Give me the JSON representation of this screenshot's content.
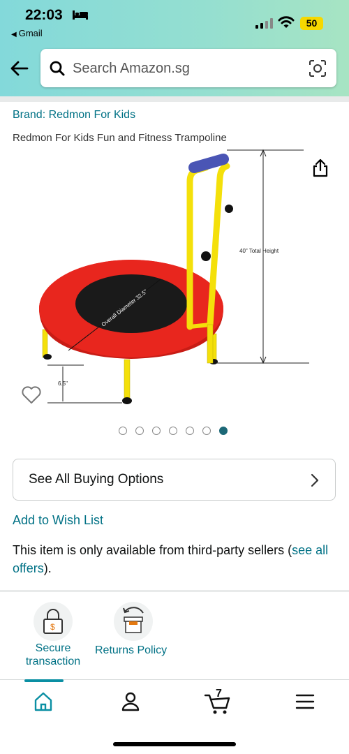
{
  "status": {
    "time": "22:03",
    "back_app": "Gmail",
    "battery": "50"
  },
  "search": {
    "placeholder": "Search Amazon.sg"
  },
  "product": {
    "brand": "Brand: Redmon For Kids",
    "title": "Redmon For Kids Fun and Fitness Trampoline",
    "image_labels": {
      "height": "40\" Total Height",
      "diameter": "Overall Diameter 32.5\"",
      "leg": "6.5\""
    },
    "carousel_count": 7,
    "carousel_active": 7
  },
  "buying_options": {
    "label": "See All Buying Options"
  },
  "wishlist": {
    "label": "Add to Wish List"
  },
  "availability": {
    "text": "This item is only available from third-party sellers (",
    "link": "see all offers",
    "suffix": ")."
  },
  "badges": [
    {
      "label": "Secure transaction",
      "icon": "lock-dollar-icon"
    },
    {
      "label": "Returns Policy",
      "icon": "return-box-icon"
    }
  ],
  "tabbar": {
    "cart_count": "7",
    "items": [
      "home-icon",
      "account-icon",
      "cart-icon",
      "menu-icon"
    ]
  },
  "colors": {
    "accent": "#007185",
    "active_dot": "#1c6877",
    "battery": "#f6d800",
    "trampoline_red": "#e8261e",
    "frame_yellow": "#f4e00a"
  }
}
